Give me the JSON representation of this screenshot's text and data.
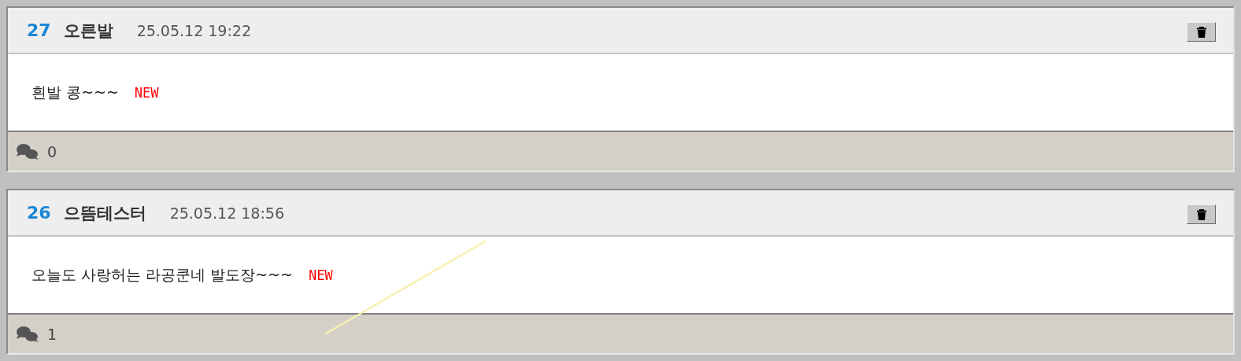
{
  "posts": [
    {
      "number": "27",
      "author": "오른발",
      "date": "25.05.12 19:22",
      "text": "흰발 콩~~~",
      "badge": "NEW",
      "comment_count": "0"
    },
    {
      "number": "26",
      "author": "으뜸테스터",
      "date": "25.05.12 18:56",
      "text": "오늘도 사랑허는 라공쿤네 발도장~~~",
      "badge": "NEW",
      "comment_count": "1"
    }
  ]
}
